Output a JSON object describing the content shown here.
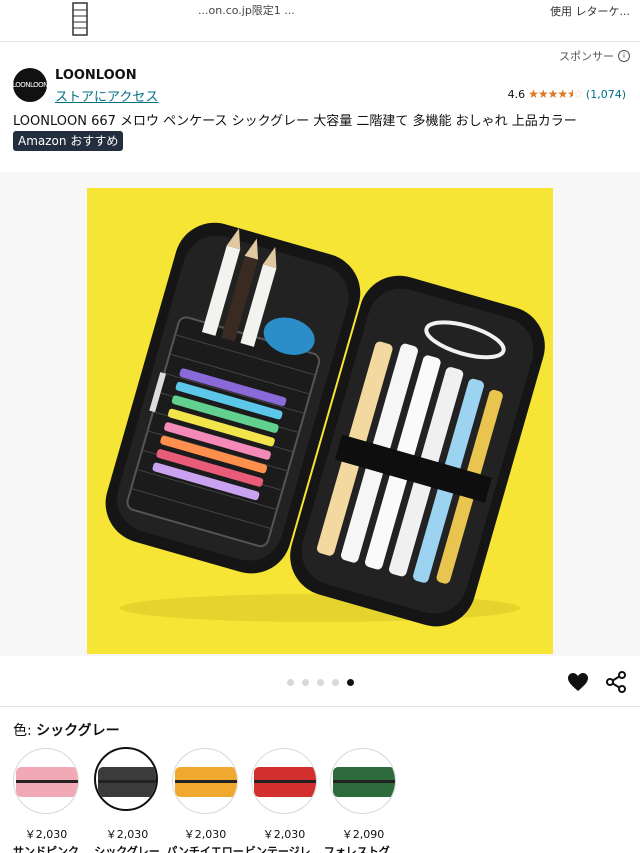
{
  "top_strip": {
    "left_text": "...on.co.jp限定1 ...",
    "right_text": "使用 レターケ..."
  },
  "sponsored": {
    "label": "スポンサー",
    "icon": "info-icon"
  },
  "brand": {
    "logo_text": "LOONLOON",
    "name": "LOONLOON",
    "store_link": "ストアにアクセス"
  },
  "rating": {
    "value": "4.6",
    "stars": 4.5,
    "count": "(1,074)"
  },
  "product": {
    "title": "LOONLOON 667 メロウ ペンケース シックグレー 大容量 二階建て 多機能 おしゃれ 上品カラー",
    "badge": "Amazon おすすめ"
  },
  "gallery": {
    "image_count": 5,
    "active_index": 4,
    "photo_background": "#f6e534"
  },
  "actions": {
    "wishlist_icon": "heart-icon",
    "share_icon": "share-icon"
  },
  "color_selector": {
    "label": "色:",
    "selected": "シックグレー",
    "options": [
      {
        "name": "サンドピンク",
        "price": "￥2,030",
        "color": "#f2a9b6"
      },
      {
        "name": "シックグレー",
        "price": "￥2,030",
        "color": "#3b3b3b"
      },
      {
        "name": "パンチイエロー",
        "price": "￥2,030",
        "color": "#f0a82e"
      },
      {
        "name": "ビンテージレ...",
        "price": "￥2,030",
        "color": "#d32f2f"
      },
      {
        "name": "フォレストグ...",
        "price": "￥2,090",
        "color": "#2e6b3c"
      }
    ]
  }
}
